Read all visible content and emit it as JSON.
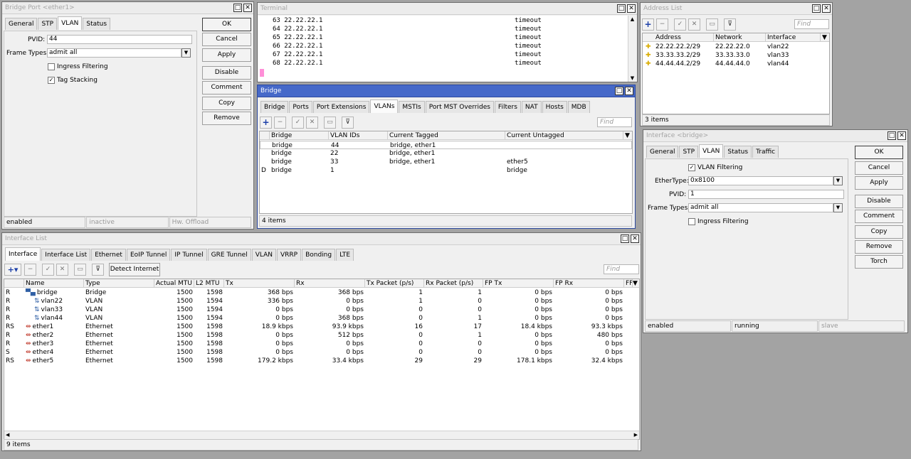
{
  "bridgePort": {
    "title": "Bridge Port <ether1>",
    "tabs": [
      "General",
      "STP",
      "VLAN",
      "Status"
    ],
    "pvid_label": "PVID:",
    "pvid": "44",
    "frame_types_label": "Frame Types:",
    "frame_types": "admit all",
    "ingress_label": "Ingress Filtering",
    "tag_label": "Tag Stacking",
    "buttons": [
      "OK",
      "Cancel",
      "Apply",
      "Disable",
      "Comment",
      "Copy",
      "Remove"
    ],
    "status": [
      "enabled",
      "inactive",
      "Hw. Offload"
    ]
  },
  "terminal": {
    "title": "Terminal",
    "lines": [
      {
        "seq": "63",
        "host": "22.22.22.1",
        "status": "timeout"
      },
      {
        "seq": "64",
        "host": "22.22.22.1",
        "status": "timeout"
      },
      {
        "seq": "65",
        "host": "22.22.22.1",
        "status": "timeout"
      },
      {
        "seq": "66",
        "host": "22.22.22.1",
        "status": "timeout"
      },
      {
        "seq": "67",
        "host": "22.22.22.1",
        "status": "timeout"
      },
      {
        "seq": "68",
        "host": "22.22.22.1",
        "status": "timeout"
      }
    ]
  },
  "bridge": {
    "title": "Bridge",
    "tabs": [
      "Bridge",
      "Ports",
      "Port Extensions",
      "VLANs",
      "MSTIs",
      "Port MST Overrides",
      "Filters",
      "NAT",
      "Hosts",
      "MDB"
    ],
    "find": "Find",
    "columns": [
      "Bridge",
      "VLAN IDs",
      "Current Tagged",
      "Current Untagged"
    ],
    "rows": [
      {
        "flag": "",
        "bridge": "bridge",
        "vlan": "44",
        "tagged": "bridge, ether1",
        "untagged": ""
      },
      {
        "flag": "",
        "bridge": "bridge",
        "vlan": "22",
        "tagged": "bridge, ether1",
        "untagged": ""
      },
      {
        "flag": "",
        "bridge": "bridge",
        "vlan": "33",
        "tagged": "bridge, ether1",
        "untagged": "ether5"
      },
      {
        "flag": "D",
        "bridge": "bridge",
        "vlan": "1",
        "tagged": "",
        "untagged": "bridge"
      }
    ],
    "count": "4 items"
  },
  "addressList": {
    "title": "Address List",
    "find": "Find",
    "columns": [
      "Address",
      "Network",
      "Interface"
    ],
    "rows": [
      {
        "address": "22.22.22.2/29",
        "network": "22.22.22.0",
        "interface": "vlan22"
      },
      {
        "address": "33.33.33.2/29",
        "network": "33.33.33.0",
        "interface": "vlan33"
      },
      {
        "address": "44.44.44.2/29",
        "network": "44.44.44.0",
        "interface": "vlan44"
      }
    ],
    "count": "3 items"
  },
  "ifaceBridge": {
    "title": "Interface <bridge>",
    "tabs": [
      "General",
      "STP",
      "VLAN",
      "Status",
      "Traffic"
    ],
    "vlan_filtering_label": "VLAN Filtering",
    "ethertype_label": "EtherType:",
    "ethertype": "0x8100",
    "pvid_label": "PVID:",
    "pvid": "1",
    "frame_types_label": "Frame Types:",
    "frame_types": "admit all",
    "ingress_label": "Ingress Filtering",
    "buttons": [
      "OK",
      "Cancel",
      "Apply",
      "Disable",
      "Comment",
      "Copy",
      "Remove",
      "Torch"
    ],
    "status": [
      "enabled",
      "running",
      "slave"
    ]
  },
  "interfaceList": {
    "title": "Interface List",
    "tabs": [
      "Interface",
      "Interface List",
      "Ethernet",
      "EoIP Tunnel",
      "IP Tunnel",
      "GRE Tunnel",
      "VLAN",
      "VRRP",
      "Bonding",
      "LTE"
    ],
    "detect_label": "Detect Internet",
    "find": "Find",
    "columns": [
      "Name",
      "Type",
      "Actual MTU",
      "L2 MTU",
      "Tx",
      "Rx",
      "Tx Packet (p/s)",
      "Rx Packet (p/s)",
      "FP Tx",
      "FP Rx",
      "FF"
    ],
    "rows": [
      {
        "flag": "R",
        "name": "bridge",
        "type": "Bridge",
        "mtu": "1500",
        "l2": "1598",
        "tx": "368 bps",
        "rx": "368 bps",
        "txp": "1",
        "rxp": "1",
        "fptx": "0 bps",
        "fprx": "0 bps",
        "icon": "bridge",
        "indent": false
      },
      {
        "flag": "R",
        "name": "vlan22",
        "type": "VLAN",
        "mtu": "1500",
        "l2": "1594",
        "tx": "336 bps",
        "rx": "0 bps",
        "txp": "1",
        "rxp": "0",
        "fptx": "0 bps",
        "fprx": "0 bps",
        "icon": "vlan",
        "indent": true
      },
      {
        "flag": "R",
        "name": "vlan33",
        "type": "VLAN",
        "mtu": "1500",
        "l2": "1594",
        "tx": "0 bps",
        "rx": "0 bps",
        "txp": "0",
        "rxp": "0",
        "fptx": "0 bps",
        "fprx": "0 bps",
        "icon": "vlan",
        "indent": true
      },
      {
        "flag": "R",
        "name": "vlan44",
        "type": "VLAN",
        "mtu": "1500",
        "l2": "1594",
        "tx": "0 bps",
        "rx": "368 bps",
        "txp": "0",
        "rxp": "1",
        "fptx": "0 bps",
        "fprx": "0 bps",
        "icon": "vlan",
        "indent": true
      },
      {
        "flag": "RS",
        "name": "ether1",
        "type": "Ethernet",
        "mtu": "1500",
        "l2": "1598",
        "tx": "18.9 kbps",
        "rx": "93.9 kbps",
        "txp": "16",
        "rxp": "17",
        "fptx": "18.4 kbps",
        "fprx": "93.3 kbps",
        "icon": "ether",
        "indent": false
      },
      {
        "flag": "R",
        "name": "ether2",
        "type": "Ethernet",
        "mtu": "1500",
        "l2": "1598",
        "tx": "0 bps",
        "rx": "512 bps",
        "txp": "0",
        "rxp": "1",
        "fptx": "0 bps",
        "fprx": "480 bps",
        "icon": "ether",
        "indent": false
      },
      {
        "flag": "R",
        "name": "ether3",
        "type": "Ethernet",
        "mtu": "1500",
        "l2": "1598",
        "tx": "0 bps",
        "rx": "0 bps",
        "txp": "0",
        "rxp": "0",
        "fptx": "0 bps",
        "fprx": "0 bps",
        "icon": "ether",
        "indent": false
      },
      {
        "flag": "S",
        "name": "ether4",
        "type": "Ethernet",
        "mtu": "1500",
        "l2": "1598",
        "tx": "0 bps",
        "rx": "0 bps",
        "txp": "0",
        "rxp": "0",
        "fptx": "0 bps",
        "fprx": "0 bps",
        "icon": "ether",
        "indent": false
      },
      {
        "flag": "RS",
        "name": "ether5",
        "type": "Ethernet",
        "mtu": "1500",
        "l2": "1598",
        "tx": "179.2 kbps",
        "rx": "33.4 kbps",
        "txp": "29",
        "rxp": "29",
        "fptx": "178.1 kbps",
        "fprx": "32.4 kbps",
        "icon": "ether",
        "indent": false
      }
    ],
    "count": "9 items"
  },
  "colors": {
    "titlebar_active": "#4669c9",
    "desktop": "#a3a3a3",
    "terminal_cursor": "#ff8fd8",
    "add_icon": "#1c3fa8"
  }
}
